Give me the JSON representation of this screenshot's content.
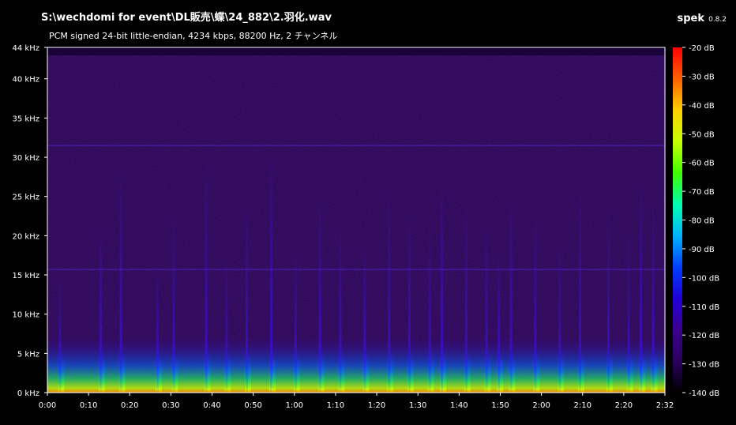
{
  "header": {
    "file_path": "S:\\wechdomi for event\\DL販売\\蝶\\24_882\\2.羽化.wav",
    "stream_info": "PCM signed 24-bit little-endian, 4234 kbps, 88200 Hz, 2 チャンネル",
    "app_name": "spek",
    "app_version": "0.8.2"
  },
  "chart_data": {
    "type": "heatmap",
    "x_axis": {
      "ticks": [
        "0:00",
        "0:10",
        "0:20",
        "0:30",
        "0:40",
        "0:50",
        "1:00",
        "1:10",
        "1:20",
        "1:30",
        "1:40",
        "1:50",
        "2:00",
        "2:10",
        "2:20",
        "2:32"
      ],
      "range_seconds": [
        0,
        152
      ]
    },
    "y_axis": {
      "ticks": [
        "0 kHz",
        "5 kHz",
        "10 kHz",
        "15 kHz",
        "20 kHz",
        "25 kHz",
        "30 kHz",
        "35 kHz",
        "40 kHz",
        "44 kHz"
      ],
      "range_khz": [
        0,
        44
      ]
    },
    "color_scale": {
      "ticks": [
        "-20 dB",
        "-30 dB",
        "-40 dB",
        "-50 dB",
        "-60 dB",
        "-70 dB",
        "-80 dB",
        "-90 dB",
        "-100 dB",
        "-110 dB",
        "-120 dB",
        "-130 dB",
        "-140 dB"
      ],
      "range_db": [
        -140,
        -20
      ],
      "colors": [
        "#000000",
        "#2a005e",
        "#3b0090",
        "#2000d8",
        "#0040ff",
        "#00b4ff",
        "#00ffb0",
        "#40ff00",
        "#c8ff00",
        "#ffd000",
        "#ff6000",
        "#ff0000"
      ]
    },
    "transients_seconds": [
      3,
      13,
      18,
      27,
      31,
      39,
      44,
      49,
      55,
      61,
      67,
      72,
      78,
      84,
      89,
      94,
      97,
      103,
      108,
      111,
      114,
      120,
      126,
      131,
      138,
      143,
      146,
      149
    ],
    "noise_floor_color": "#25054e",
    "band_lines_khz": [
      15.7,
      31.5
    ]
  }
}
